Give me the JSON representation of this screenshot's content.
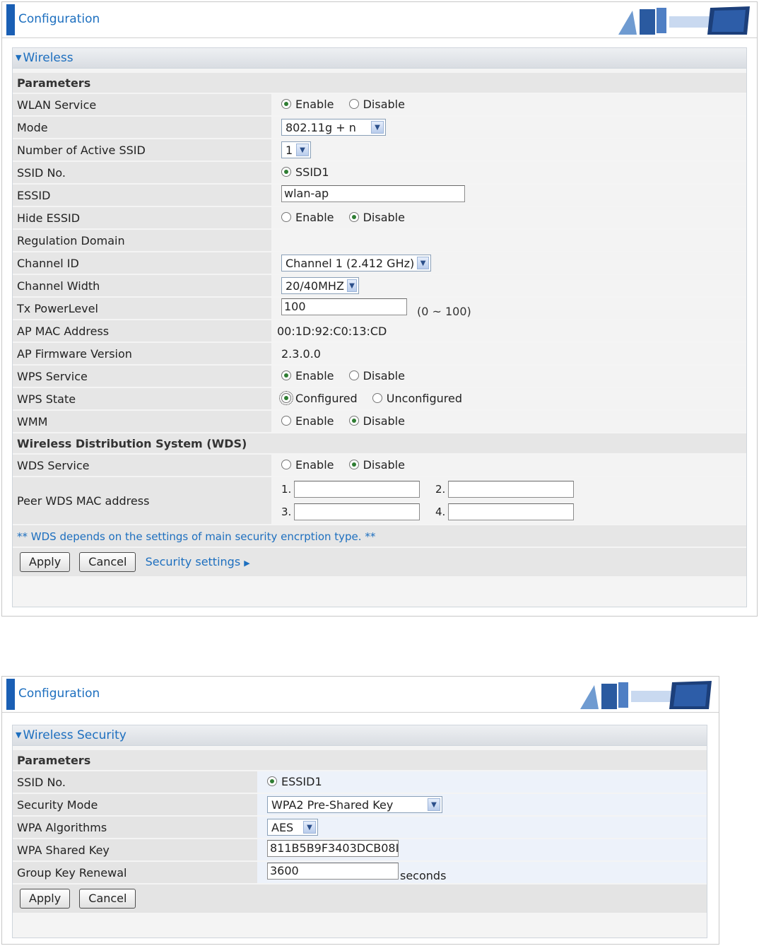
{
  "panel1": {
    "header_title": "Configuration",
    "section_title": "Wireless",
    "params_title": "Parameters",
    "rows": {
      "wlan_service": {
        "label": "WLAN Service",
        "opt1": "Enable",
        "opt2": "Disable"
      },
      "mode": {
        "label": "Mode",
        "value": "802.11g + n"
      },
      "num_ssid": {
        "label": "Number of Active SSID",
        "value": "1"
      },
      "ssid_no": {
        "label": "SSID No.",
        "opt1": "SSID1"
      },
      "essid": {
        "label": "ESSID",
        "value": "wlan-ap"
      },
      "hide_essid": {
        "label": "Hide ESSID",
        "opt1": "Enable",
        "opt2": "Disable"
      },
      "regulation": {
        "label": "Regulation Domain"
      },
      "channel_id": {
        "label": "Channel ID",
        "value": "Channel 1 (2.412 GHz)"
      },
      "channel_width": {
        "label": "Channel Width",
        "value": "20/40MHZ"
      },
      "tx_power": {
        "label": "Tx PowerLevel",
        "value": "100",
        "hint": "(0 ~ 100)"
      },
      "ap_mac": {
        "label": "AP MAC Address",
        "value": "00:1D:92:C0:13:CD"
      },
      "ap_fw": {
        "label": "AP Firmware Version",
        "value": "2.3.0.0"
      },
      "wps_service": {
        "label": "WPS Service",
        "opt1": "Enable",
        "opt2": "Disable"
      },
      "wps_state": {
        "label": "WPS State",
        "opt1": "Configured",
        "opt2": "Unconfigured"
      },
      "wmm": {
        "label": "WMM",
        "opt1": "Enable",
        "opt2": "Disable"
      }
    },
    "wds_title": "Wireless Distribution System (WDS)",
    "wds_service": {
      "label": "WDS Service",
      "opt1": "Enable",
      "opt2": "Disable"
    },
    "peer_wds": {
      "label": "Peer WDS MAC address",
      "n1": "1.",
      "n2": "2.",
      "n3": "3.",
      "n4": "4.",
      "v1": "",
      "v2": "",
      "v3": "",
      "v4": ""
    },
    "note": "** WDS depends on the settings of main security encrption type. **",
    "apply": "Apply",
    "cancel": "Cancel",
    "security_link": "Security settings"
  },
  "panel2": {
    "header_title": "Configuration",
    "section_title": "Wireless Security",
    "params_title": "Parameters",
    "ssid_no": {
      "label": "SSID No.",
      "opt1": "ESSID1"
    },
    "security_mode": {
      "label": "Security Mode",
      "value": "WPA2 Pre-Shared Key"
    },
    "wpa_alg": {
      "label": "WPA Algorithms",
      "value": "AES"
    },
    "wpa_key": {
      "label": "WPA Shared Key",
      "value": "811B5B9F3403DCB08I"
    },
    "group_key": {
      "label": "Group Key Renewal",
      "value": "3600",
      "unit": "seconds"
    },
    "apply": "Apply",
    "cancel": "Cancel"
  },
  "colors": {
    "accent": "#1d6fbf",
    "bar": "#1a5fb4",
    "radio_on": "#2e7d32"
  },
  "icons": {
    "collapse": "triangle-down-icon",
    "link_arrow": "triangle-right-icon",
    "dropdown": "chevron-down-icon"
  }
}
